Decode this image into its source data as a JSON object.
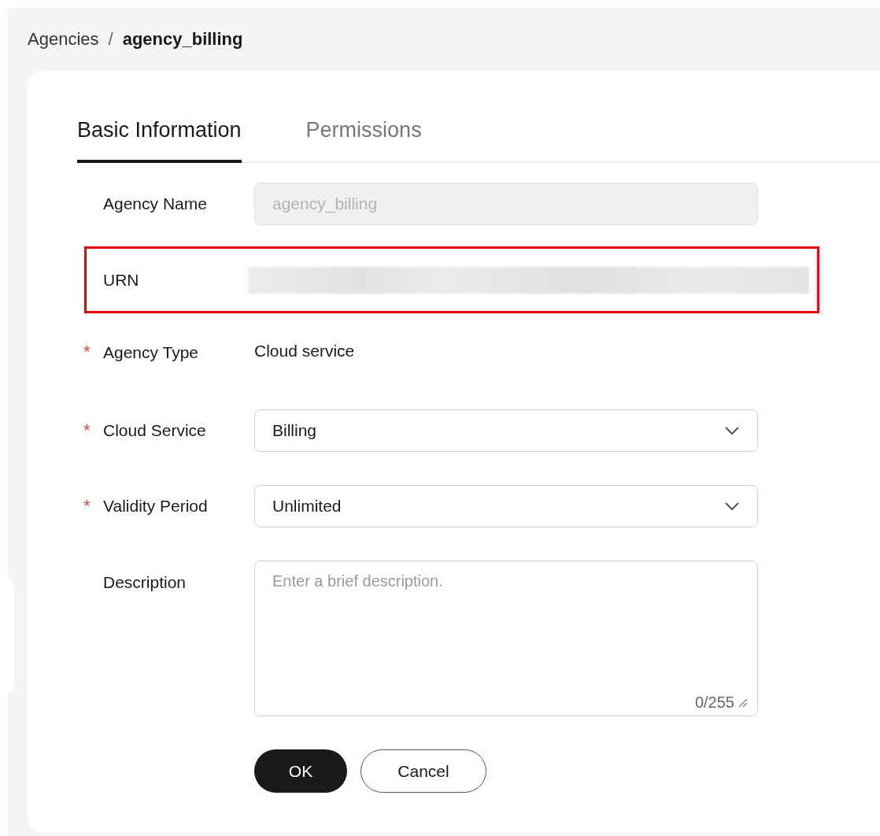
{
  "breadcrumb": [
    {
      "label": "Agencies",
      "current": false
    },
    {
      "label": "agency_billing",
      "current": true
    }
  ],
  "breadcrumb_separator": "/",
  "tabs": [
    {
      "label": "Basic Information",
      "selected": true
    },
    {
      "label": "Permissions",
      "selected": false
    }
  ],
  "fields": [
    {
      "kind": "readonly",
      "label": "Agency Name",
      "required": false,
      "value": "agency_billing",
      "highlighted": false
    },
    {
      "kind": "redacted",
      "label": "URN",
      "required": false,
      "highlighted": true
    },
    {
      "kind": "text",
      "label": "Agency Type",
      "required": true,
      "value": "Cloud service",
      "highlighted": false
    },
    {
      "kind": "select",
      "label": "Cloud Service",
      "required": true,
      "value": "Billing",
      "highlighted": false
    },
    {
      "kind": "select",
      "label": "Validity Period",
      "required": true,
      "value": "Unlimited",
      "highlighted": false
    },
    {
      "kind": "textarea",
      "label": "Description",
      "required": false,
      "placeholder": "Enter a brief description.",
      "counter": "0/255",
      "highlighted": false
    }
  ],
  "required_mark": "*",
  "buttons": [
    {
      "kind": "primary",
      "label": "OK"
    },
    {
      "kind": "secondary",
      "label": "Cancel"
    }
  ]
}
